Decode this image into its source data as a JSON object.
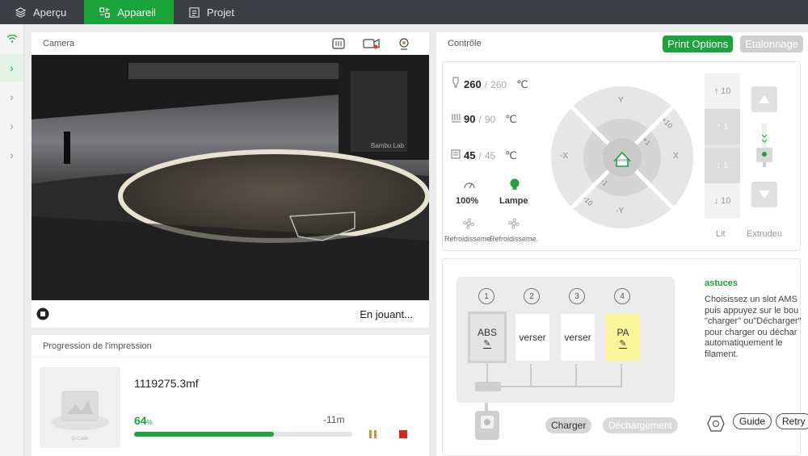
{
  "tabs": [
    {
      "label": "Aperçu"
    },
    {
      "label": "Appareil"
    },
    {
      "label": "Projet"
    }
  ],
  "camera": {
    "title": "Camera",
    "status": "En jouant..."
  },
  "progress": {
    "title": "Progression de l'impression",
    "file": "1119275.3mf",
    "percent": "64",
    "percent_unit": "%",
    "remaining": "-11m",
    "fraction": 0.64,
    "thumb_label": "G-Code"
  },
  "control": {
    "title": "Contrôle",
    "print_options": "Print Options",
    "calibration": "Etalonnage",
    "nozzle": {
      "current": "260",
      "target": "260",
      "unit": "℃"
    },
    "bed": {
      "current": "90",
      "target": "90",
      "unit": "℃"
    },
    "chamber": {
      "current": "45",
      "target": "45",
      "unit": "℃"
    },
    "speed": "100%",
    "lamp": "Lampe",
    "fan1": "Refroidisseme...",
    "fan2": "Refroidisseme...",
    "jog": {
      "y_plus": "Y",
      "y_minus": "-Y",
      "x_plus": "X",
      "x_minus": "-X",
      "p10": "+10",
      "p1": "+1",
      "m1": "-1",
      "m10": "-10"
    },
    "bed_move": {
      "up10": "10",
      "up1": "1",
      "down1": "1",
      "down10": "10",
      "label": "Lit"
    },
    "extruder_label": "Extrudeu"
  },
  "ams": {
    "slot_numbers": [
      "1",
      "2",
      "3",
      "4"
    ],
    "slots": [
      {
        "label": "ABS",
        "color": "#e4e4e4"
      },
      {
        "label": "verser",
        "color": "#ffffff"
      },
      {
        "label": "verser",
        "color": "#ffffff"
      },
      {
        "label": "PA",
        "color": "#fbf59a"
      }
    ],
    "load": "Charger",
    "unload": "Déchargement"
  },
  "tips": {
    "title": "astuces",
    "text": "Choisissez un slot AMS puis appuyez sur le bou \"charger\" ou\"Décharger\" pour charger ou déchar automatiquement le filament.",
    "guide": "Guide",
    "retry": "Retry"
  },
  "colors": {
    "accent": "#1ba33c",
    "topbar": "#3c3f44"
  }
}
